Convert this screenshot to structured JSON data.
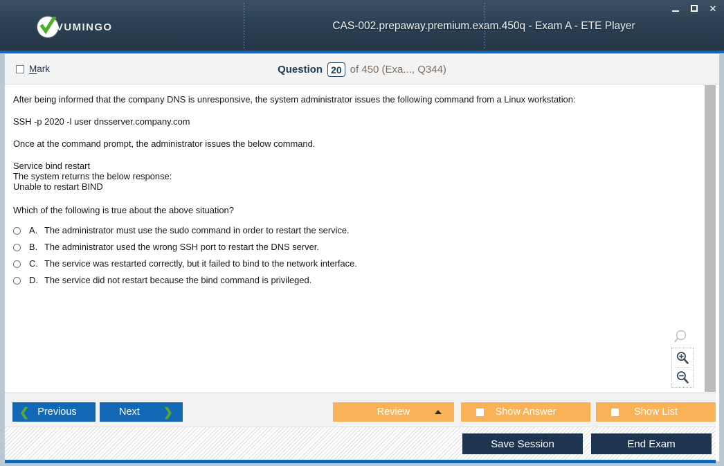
{
  "window": {
    "brand_name": "VUMINGO",
    "brand_icon": "check-circle-logo",
    "title": "CAS-002.prepaway.premium.exam.450q - Exam A - ETE Player",
    "controls": {
      "minimize": "minimize-icon",
      "maximize": "maximize-icon",
      "close": "✕"
    }
  },
  "question_header": {
    "mark_label_pre": "",
    "mark_label_accel": "M",
    "mark_label_rest": "ark",
    "question_word": "Question",
    "question_number": "20",
    "question_rest": "of 450 (Exa..., Q344)"
  },
  "question": {
    "paragraphs": [
      "After being informed that the company DNS is unresponsive, the system administrator issues the following command from a Linux workstation:",
      "SSH -p 2020 -l user dnsserver.company.com",
      "Once at the command prompt, the administrator issues the below command.",
      "Service bind restart\nThe system returns the below response:\nUnable to restart BIND",
      "Which of the following is true about the above situation?"
    ],
    "options": [
      {
        "letter": "A.",
        "text": "The administrator must use the sudo command in order to restart the service."
      },
      {
        "letter": "B.",
        "text": "The administrator used the wrong SSH port to restart the DNS server."
      },
      {
        "letter": "C.",
        "text": "The service was restarted correctly, but it failed to bind to the network interface."
      },
      {
        "letter": "D.",
        "text": "The service did not restart because the bind command is privileged."
      }
    ]
  },
  "zoom_tools": {
    "magnifier": "magnifier-icon",
    "zoom_in": "zoom-in-icon",
    "zoom_out": "zoom-out-icon"
  },
  "buttons": {
    "previous": "Previous",
    "next": "Next",
    "review": "Review",
    "show_answer": "Show Answer",
    "show_list": "Show List",
    "save_session": "Save Session",
    "end_exam": "End Exam"
  },
  "colors": {
    "titlebar_dark": "#2e4256",
    "accent_blue": "#1268b5",
    "accent_orange": "#f9b257",
    "navy_button": "#1d3550",
    "chevron_green": "#5aa832"
  }
}
